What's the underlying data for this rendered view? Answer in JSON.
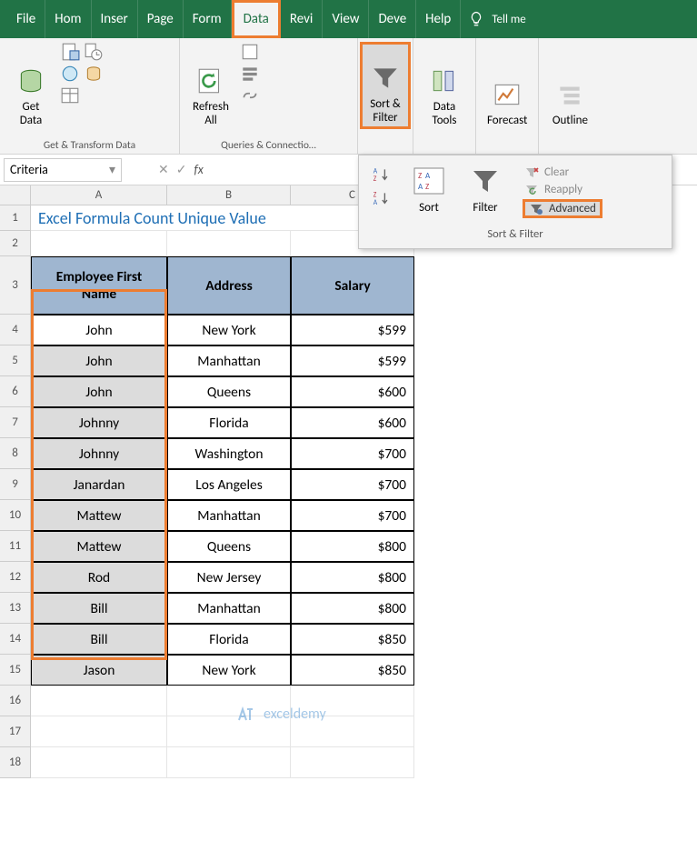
{
  "tabs": [
    "File",
    "Hom",
    "Inser",
    "Page",
    "Form",
    "Data",
    "Revi",
    "View",
    "Deve",
    "Help"
  ],
  "tellme": "Tell me",
  "ribbon": {
    "get_data": "Get\nData",
    "refresh": "Refresh\nAll",
    "sort_filter": "Sort &\nFilter",
    "data_tools": "Data\nTools",
    "forecast": "Forecast",
    "outline": "Outline",
    "grp_transform": "Get & Transform Data",
    "grp_queries": "Queries & Connectio…"
  },
  "sf": {
    "sort": "Sort",
    "filter": "Filter",
    "clear": "Clear",
    "reapply": "Reapply",
    "advanced": "Advanced",
    "title": "Sort & Filter"
  },
  "namebox": "Criteria",
  "fx": "fx",
  "cols": [
    "A",
    "B",
    "C"
  ],
  "title": "Excel Formula Count Unique Value",
  "headers": {
    "c1": "Employee First Name",
    "c2": "Address",
    "c3": "Salary"
  },
  "chart_data": {
    "type": "table",
    "columns": [
      "Employee First Name",
      "Address",
      "Salary"
    ],
    "rows": [
      {
        "name": "John",
        "address": "New York",
        "salary": "$599"
      },
      {
        "name": "John",
        "address": "Manhattan",
        "salary": "$599"
      },
      {
        "name": "John",
        "address": "Queens",
        "salary": "$600"
      },
      {
        "name": "Johnny",
        "address": "Florida",
        "salary": "$600"
      },
      {
        "name": "Johnny",
        "address": "Washington",
        "salary": "$700"
      },
      {
        "name": "Janardan",
        "address": "Los Angeles",
        "salary": "$700"
      },
      {
        "name": "Mattew",
        "address": "Manhattan",
        "salary": "$700"
      },
      {
        "name": "Mattew",
        "address": "Queens",
        "salary": "$800"
      },
      {
        "name": "Rod",
        "address": "New Jersey",
        "salary": "$800"
      },
      {
        "name": "Bill",
        "address": "Manhattan",
        "salary": "$800"
      },
      {
        "name": "Bill",
        "address": "Florida",
        "salary": "$850"
      },
      {
        "name": "Jason",
        "address": "New York",
        "salary": "$850"
      }
    ]
  },
  "rownums": [
    "1",
    "2",
    "3",
    "4",
    "5",
    "6",
    "7",
    "8",
    "9",
    "10",
    "11",
    "12",
    "13",
    "14",
    "15",
    "16",
    "17",
    "18"
  ],
  "watermark": "exceldemy"
}
